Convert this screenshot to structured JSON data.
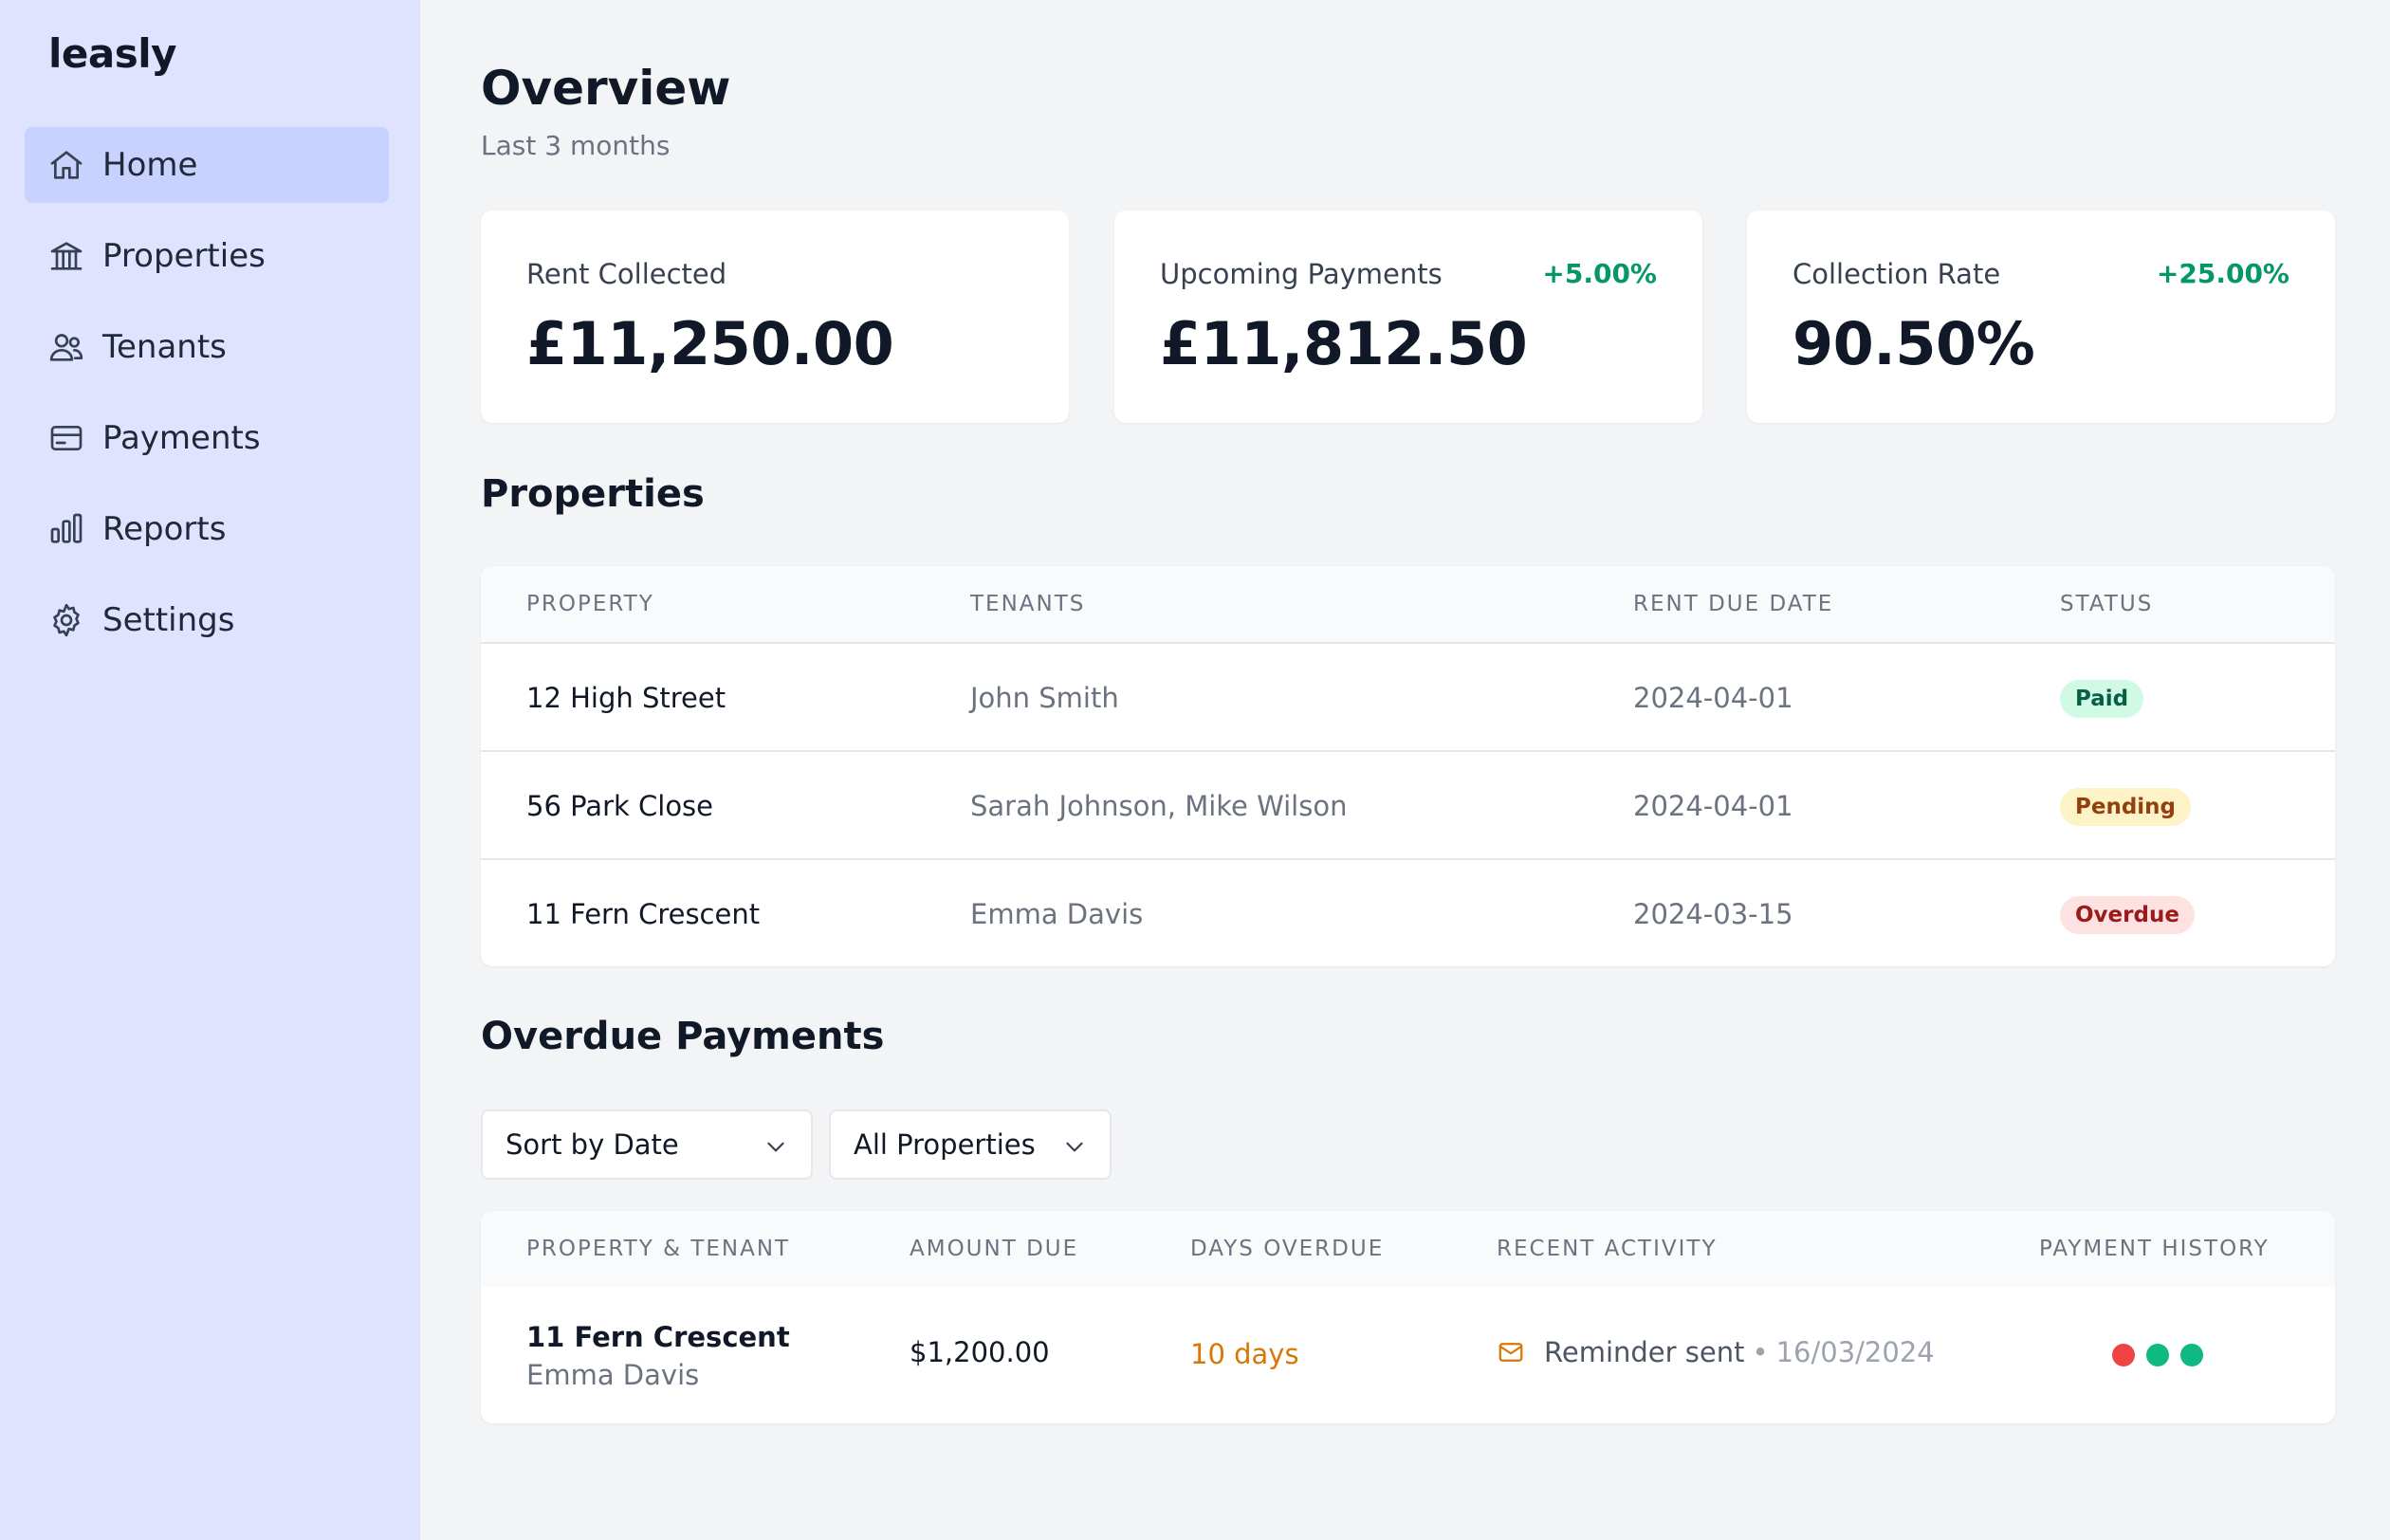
{
  "app": {
    "logo": "leasly"
  },
  "sidebar": {
    "items": [
      {
        "label": "Home",
        "icon": "home-icon",
        "active": true
      },
      {
        "label": "Properties",
        "icon": "building-icon",
        "active": false
      },
      {
        "label": "Tenants",
        "icon": "users-icon",
        "active": false
      },
      {
        "label": "Payments",
        "icon": "credit-card-icon",
        "active": false
      },
      {
        "label": "Reports",
        "icon": "bar-chart-icon",
        "active": false
      },
      {
        "label": "Settings",
        "icon": "gear-icon",
        "active": false
      }
    ]
  },
  "overview": {
    "title": "Overview",
    "subtitle": "Last 3 months"
  },
  "stats": [
    {
      "label": "Rent Collected",
      "value": "£11,250.00",
      "change": ""
    },
    {
      "label": "Upcoming Payments",
      "value": "£11,812.50",
      "change": "+5.00%"
    },
    {
      "label": "Collection Rate",
      "value": "90.50%",
      "change": "+25.00%"
    }
  ],
  "properties": {
    "title": "Properties",
    "columns": [
      "Property",
      "Tenants",
      "Rent Due Date",
      "Status"
    ],
    "rows": [
      {
        "property": "12 High Street",
        "tenants": "John Smith",
        "due": "2024-04-01",
        "status": "Paid"
      },
      {
        "property": "56 Park Close",
        "tenants": "Sarah Johnson, Mike Wilson",
        "due": "2024-04-01",
        "status": "Pending"
      },
      {
        "property": "11 Fern Crescent",
        "tenants": "Emma Davis",
        "due": "2024-03-15",
        "status": "Overdue"
      }
    ]
  },
  "overdue": {
    "title": "Overdue Payments",
    "sort_select": "Sort by Date",
    "property_select": "All Properties",
    "columns": [
      "Property & Tenant",
      "Amount Due",
      "Days Overdue",
      "Recent Activity",
      "Payment History"
    ],
    "rows": [
      {
        "property": "11 Fern Crescent",
        "tenant": "Emma Davis",
        "amount": "$1,200.00",
        "days": "10 days",
        "activity": "Reminder sent",
        "activity_sep": "•",
        "activity_date": "16/03/2024",
        "history_colors": [
          "#ef4444",
          "#10b981",
          "#10b981"
        ]
      }
    ]
  },
  "colors": {
    "sidebar_bg": "#e0e3ff",
    "active_nav": "#c7d2fe",
    "positive": "#059669",
    "warning": "#d97706"
  }
}
